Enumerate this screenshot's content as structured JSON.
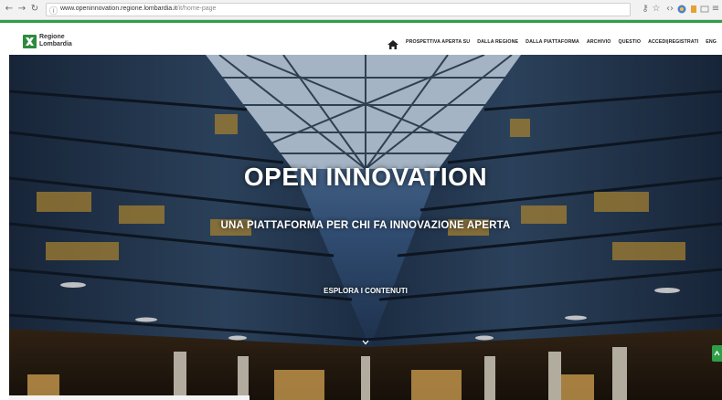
{
  "browser": {
    "url_host": "www.openinnovation.regione.lombardia.it",
    "url_path": "/it/home-page",
    "icons": {
      "back": "back-arrow-icon",
      "forward": "forward-arrow-icon",
      "reload": "reload-icon",
      "info": "info-icon"
    }
  },
  "header": {
    "logo_text": "Regione\nLombardia",
    "nav": [
      "PROSPETTIVA APERTA SU",
      "DALLA REGIONE",
      "DALLA PIATTAFORMA",
      "ARCHIVIO",
      "QUESTIO",
      "ACCEDI|REGISTRATI",
      "ENG"
    ]
  },
  "hero": {
    "title": "OPEN INNOVATION",
    "subtitle": "UNA PIATTAFORMA PER CHI FA INNOVAZIONE APERTA",
    "cta": "ESPLORA I CONTENUTI"
  },
  "colors": {
    "accent_green": "#2f9e47",
    "brand_green": "#2e8b3d"
  }
}
